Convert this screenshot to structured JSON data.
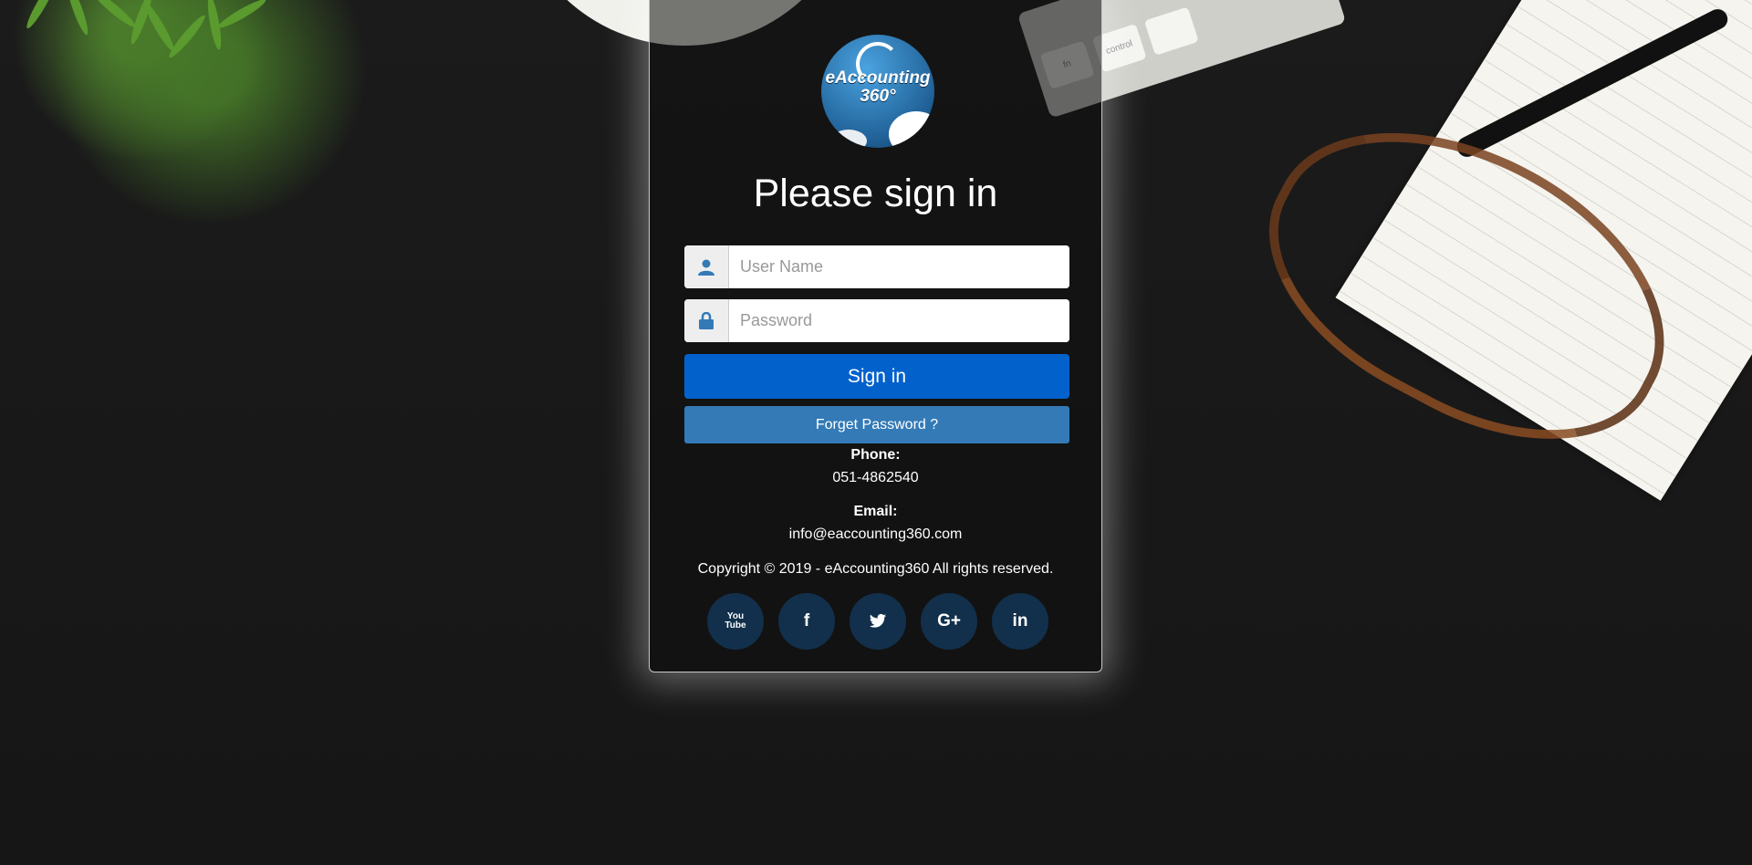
{
  "login": {
    "logo_text_line1": "eAccounting",
    "logo_text_line2": "360°",
    "title": "Please sign in",
    "username_placeholder": "User Name",
    "password_placeholder": "Password",
    "signin_label": "Sign in",
    "forget_label": "Forget Password ?"
  },
  "contact": {
    "phone_label": "Phone:",
    "phone_value": "051-4862540",
    "email_label": "Email:",
    "email_value": "info@eaccounting360.com",
    "copyright": "Copyright © 2019 - eAccounting360 All rights reserved."
  },
  "socials": {
    "youtube": "You Tube",
    "facebook": "f",
    "twitter": "🐦",
    "googleplus": "G+",
    "linkedin": "in"
  },
  "background": {
    "keys": [
      "fn",
      "control"
    ]
  },
  "colors": {
    "signin_button": "#0361cc",
    "forget_button": "#337ab7",
    "social_button": "#12304c",
    "icon_blue": "#337ab7"
  }
}
